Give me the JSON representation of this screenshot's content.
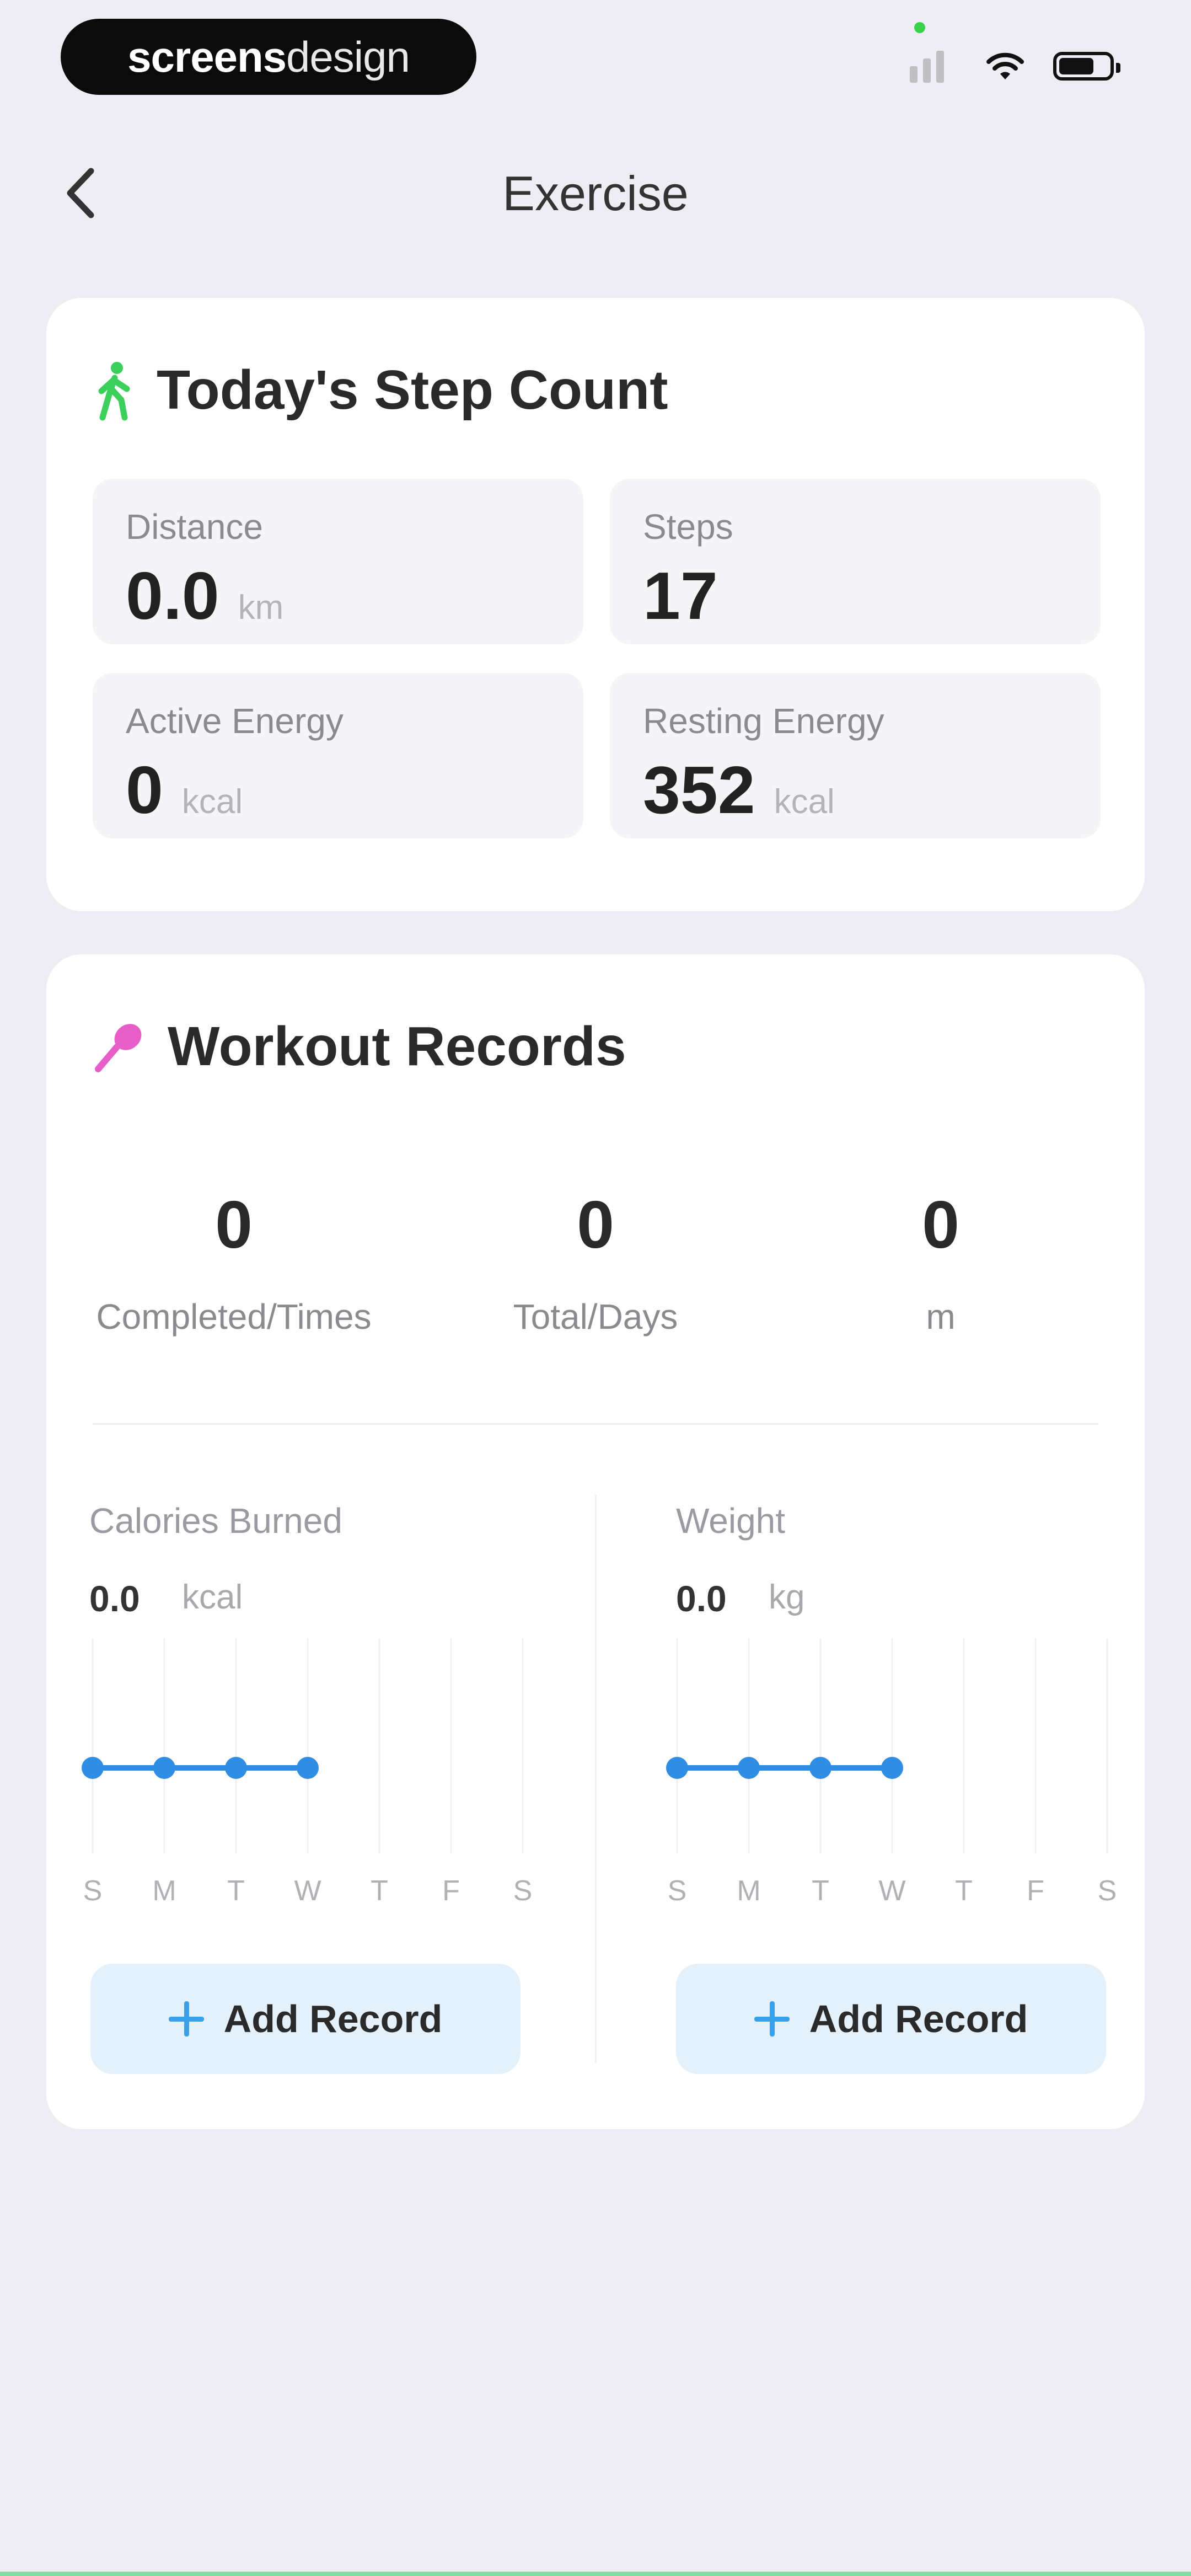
{
  "status_bar": {
    "brand_bold": "screens",
    "brand_light": "design"
  },
  "nav": {
    "title": "Exercise",
    "back_icon": "chevron-left-icon"
  },
  "step_card": {
    "title": "Today's Step Count",
    "icon": "walking-person-icon",
    "icon_color": "#3ccf5c",
    "tiles": [
      {
        "label": "Distance",
        "value": "0.0",
        "unit": "km"
      },
      {
        "label": "Steps",
        "value": "17",
        "unit": ""
      },
      {
        "label": "Active Energy",
        "value": "0",
        "unit": "kcal"
      },
      {
        "label": "Resting Energy",
        "value": "352",
        "unit": "kcal"
      }
    ]
  },
  "workout_card": {
    "title": "Workout Records",
    "icon": "badminton-racket-icon",
    "icon_color": "#e85ec8",
    "stats": [
      {
        "value": "0",
        "label": "Completed/Times"
      },
      {
        "value": "0",
        "label": "Total/Days"
      },
      {
        "value": "0",
        "label": "m"
      }
    ],
    "calories": {
      "label": "Calories Burned",
      "value": "0.0",
      "unit": "kcal",
      "add_label": "Add Record"
    },
    "weight": {
      "label": "Weight",
      "value": "0.0",
      "unit": "kg",
      "add_label": "Add Record"
    }
  },
  "chart_data": [
    {
      "type": "line",
      "categories": [
        "S",
        "M",
        "T",
        "W",
        "T",
        "F",
        "S"
      ],
      "series": [
        {
          "values": [
            0,
            0,
            0,
            0
          ]
        }
      ],
      "color": "#2f8de4"
    },
    {
      "type": "line",
      "categories": [
        "S",
        "M",
        "T",
        "W",
        "T",
        "F",
        "S"
      ],
      "series": [
        {
          "values": [
            0,
            0,
            0,
            0
          ]
        }
      ],
      "color": "#2f8de4"
    }
  ]
}
